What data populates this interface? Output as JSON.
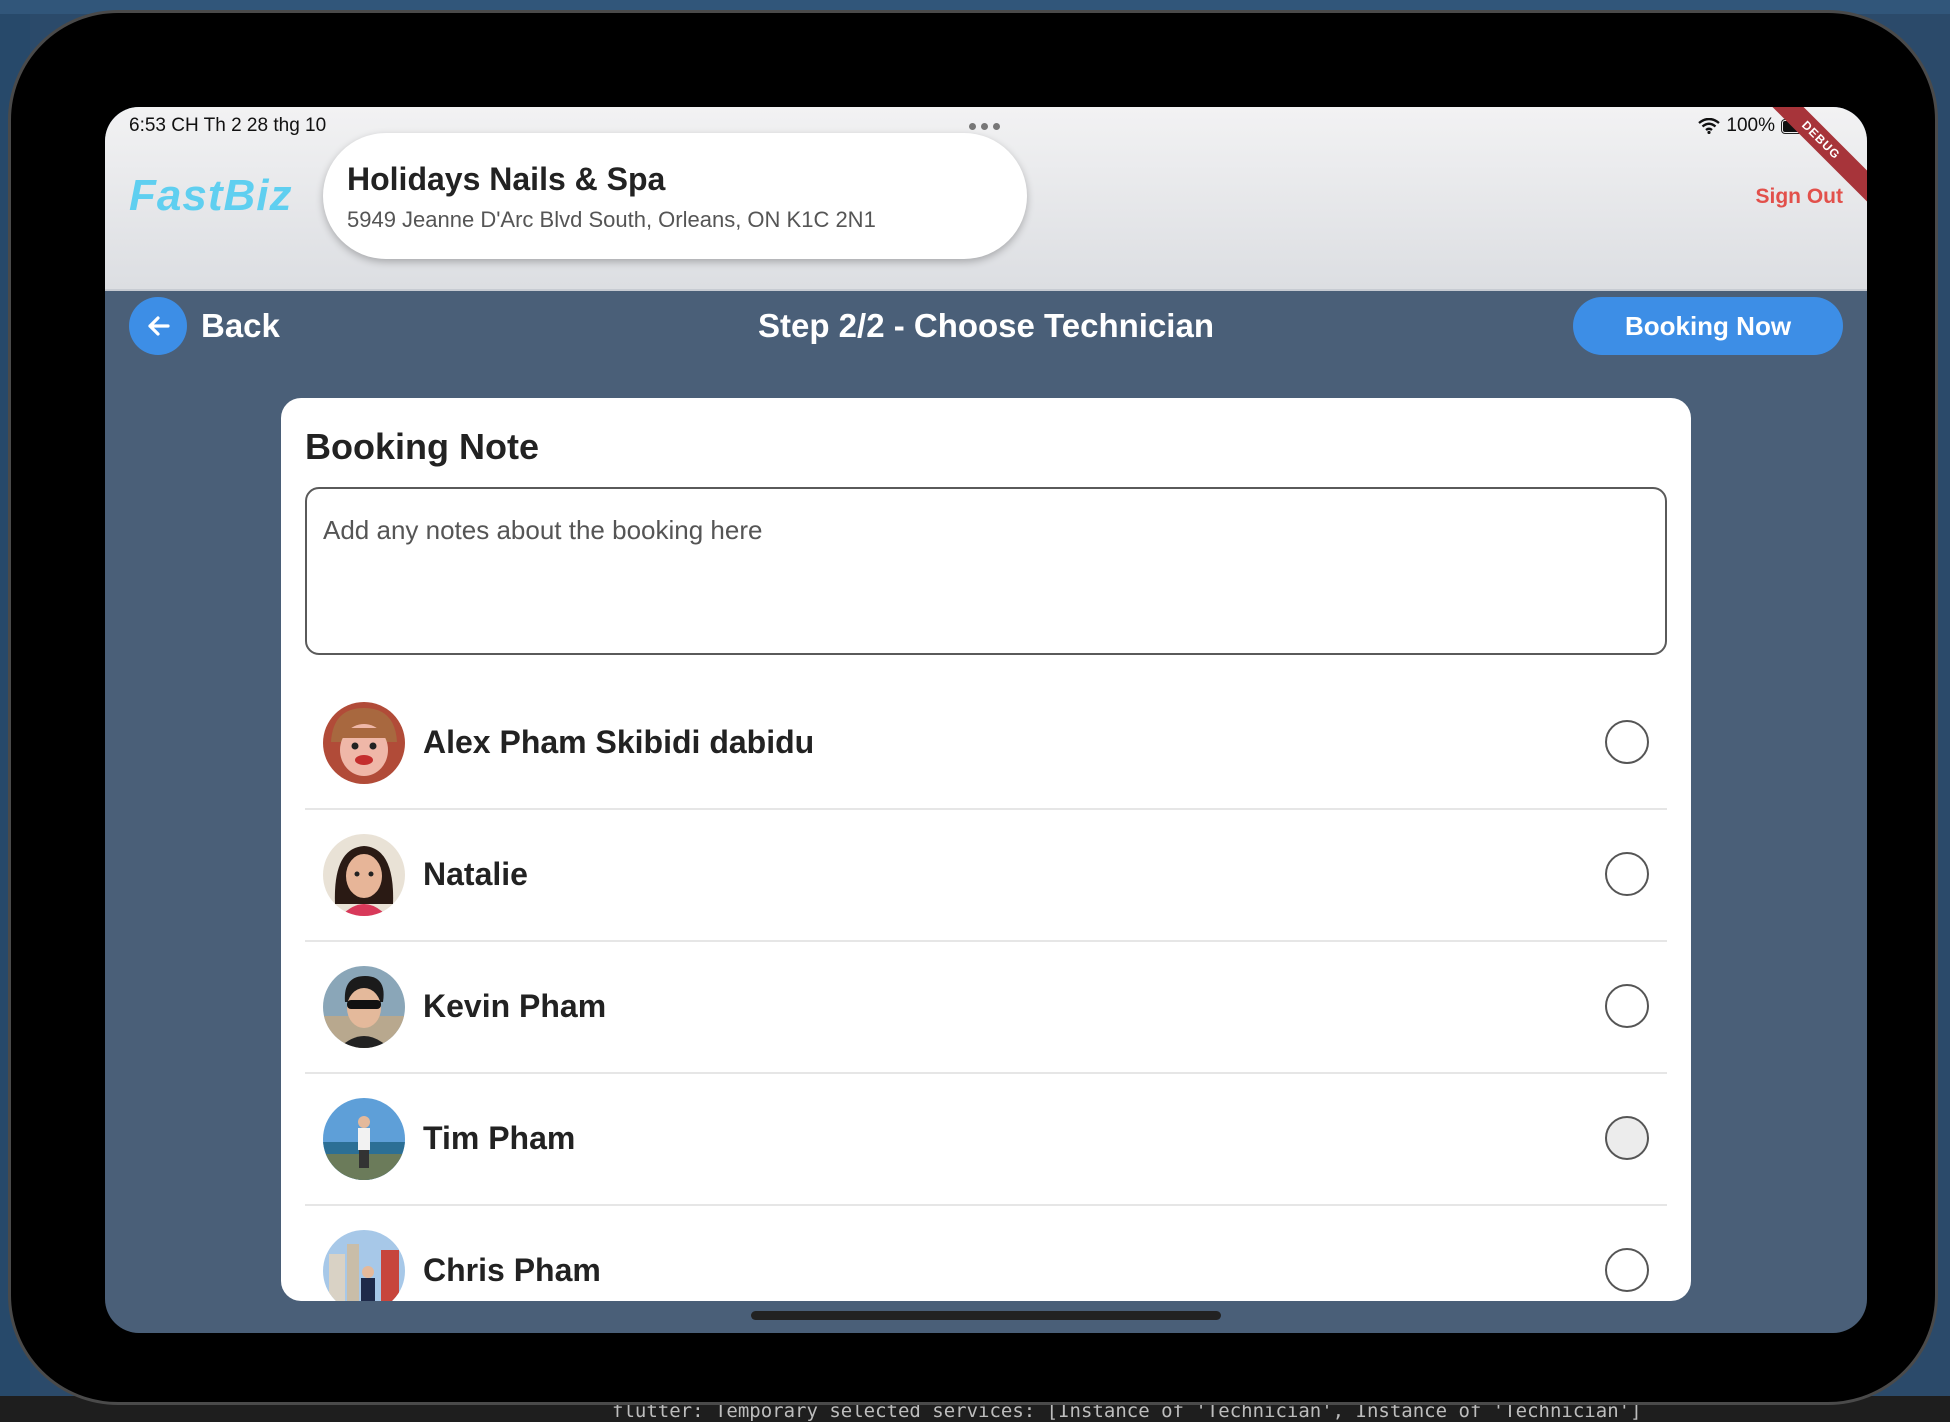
{
  "status_bar": {
    "time_date": "6:53 CH   Th 2 28 thg 10",
    "battery": "100%"
  },
  "debug_banner": "DEBUG",
  "header": {
    "logo": "FastBiz",
    "store_name": "Holidays Nails & Spa",
    "store_address": "5949 Jeanne D'Arc Blvd South, Orleans, ON K1C 2N1",
    "sign_out": "Sign Out"
  },
  "nav": {
    "back": "Back",
    "title": "Step 2/2 - Choose Technician",
    "booking_now": "Booking Now"
  },
  "booking_note": {
    "title": "Booking Note",
    "placeholder": "Add any notes about the booking here",
    "value": ""
  },
  "technicians": [
    {
      "name": "Alex Pham Skibidi dabidu",
      "selected": false
    },
    {
      "name": "Natalie",
      "selected": false
    },
    {
      "name": "Kevin Pham",
      "selected": false
    },
    {
      "name": "Tim Pham",
      "selected": false
    },
    {
      "name": "Chris Pham",
      "selected": false
    }
  ],
  "console": "flutter: Temporary selected services: [Instance of 'Technician', Instance of 'Technician']",
  "colors": {
    "accent": "#3d8ee6",
    "logo": "#5fcff0",
    "sign_out": "#e2504b",
    "content_bg": "#4a5f78"
  }
}
